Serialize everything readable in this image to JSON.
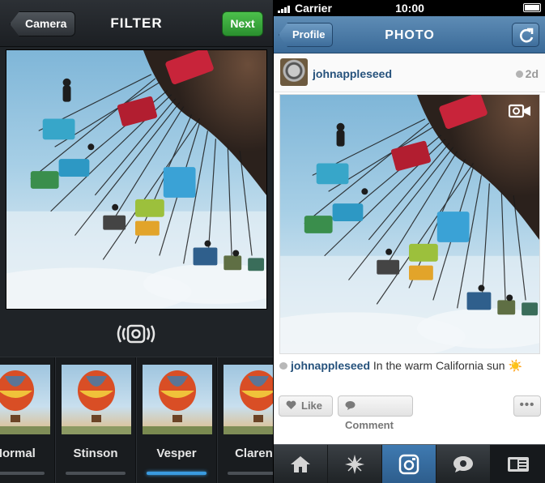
{
  "filter_screen": {
    "back_button": "Camera",
    "title": "FILTER",
    "next_button": "Next",
    "filters": [
      {
        "label": "Normal",
        "active": false
      },
      {
        "label": "Stinson",
        "active": false
      },
      {
        "label": "Vesper",
        "active": true
      },
      {
        "label": "Clarend",
        "active": false
      }
    ],
    "camera_toggle_icon": "camera-stabilize-icon"
  },
  "photo_screen": {
    "status_bar": {
      "carrier": "Carrier",
      "time": "10:00"
    },
    "back_button": "Profile",
    "title": "PHOTO",
    "refresh_icon": "refresh-icon",
    "post": {
      "username": "johnappleseed",
      "age": "2d",
      "media_badge_icon": "video-camera-icon",
      "caption_user": "johnappleseed",
      "caption_text": "In the warm California sun",
      "caption_emoji": "☀️"
    },
    "actions": {
      "like": "Like",
      "comment": "Comment",
      "more": "•••"
    },
    "tabs": [
      "home-icon",
      "explore-icon",
      "camera-icon",
      "activity-icon",
      "profile-icon"
    ],
    "active_tab": "camera-icon"
  },
  "colors": {
    "accent_green": "#2a8f2f",
    "nav_blue": "#3a6a98",
    "username_blue": "#26527c",
    "active_filter_bar": "#3a9be0"
  }
}
